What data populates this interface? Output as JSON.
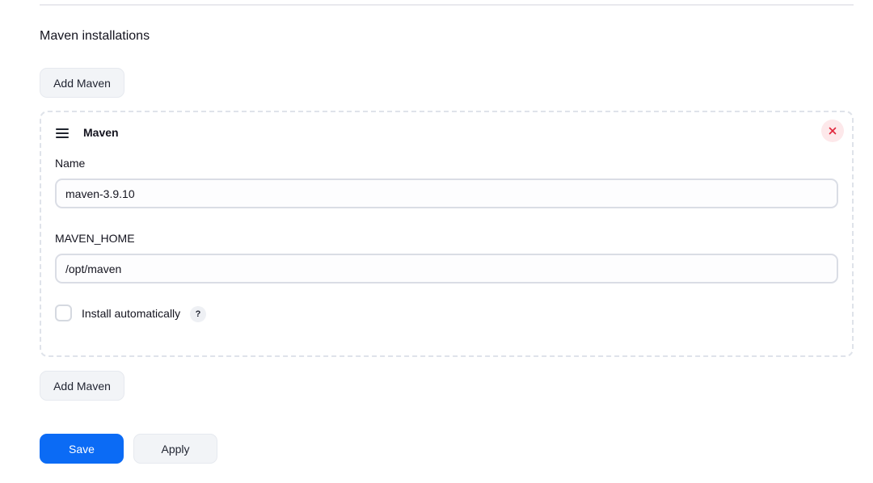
{
  "section": {
    "title": "Maven installations",
    "add_button_label": "Add Maven"
  },
  "installation": {
    "title": "Maven",
    "name_label": "Name",
    "name_value": "maven-3.9.10",
    "home_label": "MAVEN_HOME",
    "home_value": "/opt/maven",
    "install_auto_label": "Install automatically",
    "install_auto_checked": false,
    "help_glyph": "?"
  },
  "actions": {
    "save_label": "Save",
    "apply_label": "Apply"
  },
  "colors": {
    "primary": "#0b6bf5",
    "danger": "#e0253a",
    "danger_bg": "#fde8ea"
  }
}
